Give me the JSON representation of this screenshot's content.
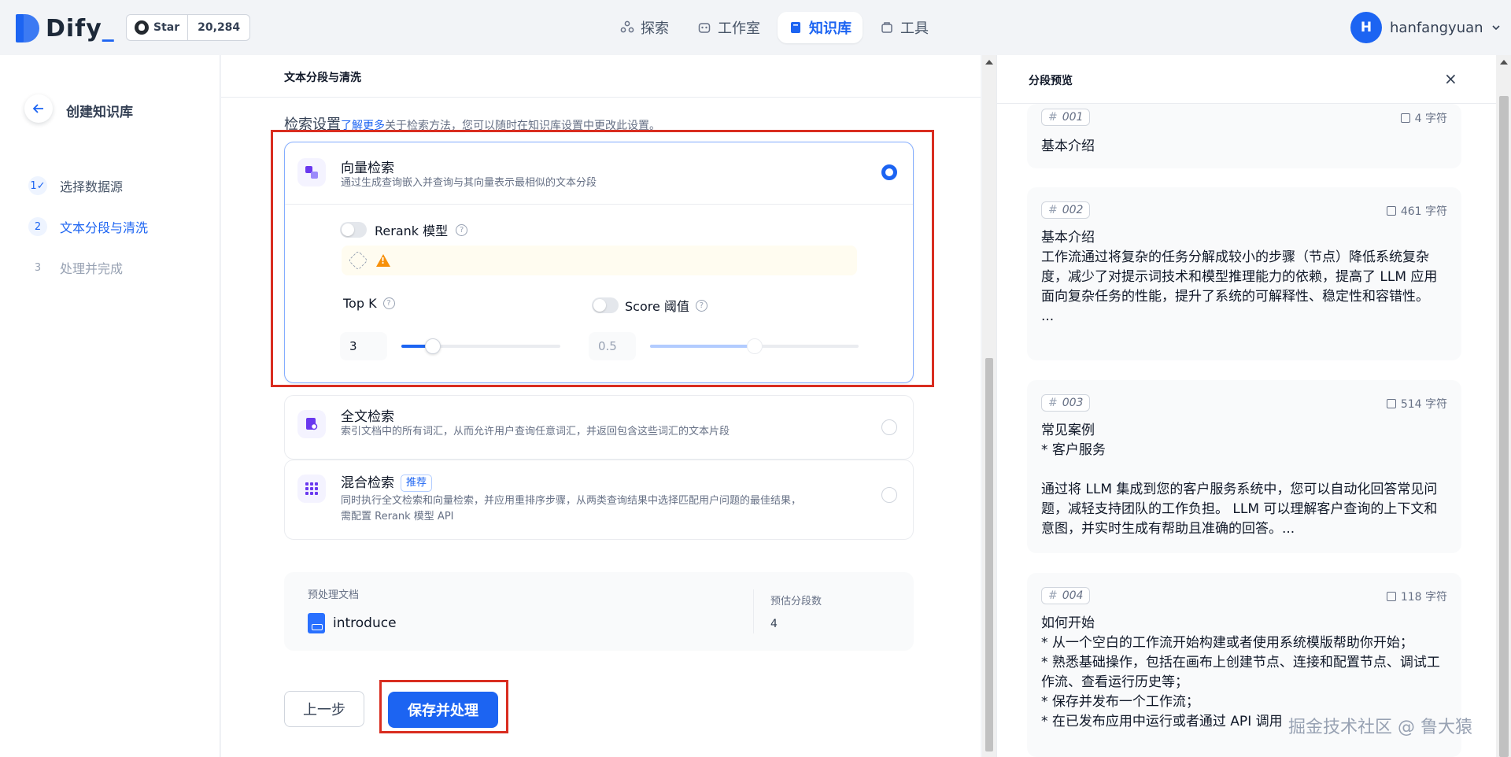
{
  "app": {
    "logo_text": "Dify",
    "github": {
      "star_label": "Star",
      "star_count": "20,284"
    }
  },
  "nav": [
    {
      "label": "探索",
      "icon": "explore-icon",
      "active": false
    },
    {
      "label": "工作室",
      "icon": "robot-icon",
      "active": false
    },
    {
      "label": "知识库",
      "icon": "book-icon",
      "active": true
    },
    {
      "label": "工具",
      "icon": "toolbox-icon",
      "active": false
    }
  ],
  "user": {
    "initial": "H",
    "name": "hanfangyuan"
  },
  "sidebar": {
    "title": "创建知识库",
    "steps": [
      {
        "num": "1",
        "label": "选择数据源",
        "state": "done"
      },
      {
        "num": "2",
        "label": "文本分段与清洗",
        "state": "active"
      },
      {
        "num": "3",
        "label": "处理并完成",
        "state": "pending"
      }
    ]
  },
  "main": {
    "header": "文本分段与清洗",
    "retrieval": {
      "section_title": "检索设置",
      "learn_more": "了解更多",
      "hint": "关于检索方法，您可以随时在知识库设置中更改此设置。",
      "vector": {
        "title": "向量检索",
        "desc": "通过生成查询嵌入并查询与其向量表示最相似的文本分段",
        "rerank_label": "Rerank 模型",
        "topk_label": "Top K",
        "topk_value": "3",
        "topk_fraction": 0.2,
        "score_label": "Score 阈值",
        "score_value": "0.5",
        "score_fraction": 0.5
      },
      "fulltext": {
        "title": "全文检索",
        "desc": "索引文档中的所有词汇，从而允许用户查询任意词汇，并返回包含这些词汇的文本片段"
      },
      "hybrid": {
        "title": "混合检索",
        "badge": "推荐",
        "desc_line1": "同时执行全文检索和向量检索，并应用重排序步骤，从两类查询结果中选择匹配用户问题的最佳结果，",
        "desc_line2": "需配置 Rerank 模型 API"
      }
    },
    "stats": {
      "doc_label": "预处理文档",
      "doc_name": "introduce",
      "seg_label": "预估分段数",
      "seg_count": "4"
    },
    "buttons": {
      "prev": "上一步",
      "save": "保存并处理"
    }
  },
  "preview": {
    "title": "分段预览",
    "close": "×",
    "segments": [
      {
        "id": "001",
        "chars": "4 字符",
        "content": "基本介绍"
      },
      {
        "id": "002",
        "chars": "461 字符",
        "content": "基本介绍\n工作流通过将复杂的任务分解成较小的步骤（节点）降低系统复杂度，减少了对提示词技术和模型推理能力的依赖，提高了 LLM 应用面向复杂任务的性能，提升了系统的可解释性、稳定性和容错性。\n..."
      },
      {
        "id": "003",
        "chars": "514 字符",
        "content": "常见案例\n* 客户服务\n\n通过将 LLM 集成到您的客户服务系统中，您可以自动化回答常见问题，减轻支持团队的工作负担。 LLM 可以理解客户查询的上下文和意图，并实时生成有帮助且准确的回答。..."
      },
      {
        "id": "004",
        "chars": "118 字符",
        "content": "如何开始\n* 从一个空白的工作流开始构建或者使用系统模版帮助你开始；\n* 熟悉基础操作，包括在画布上创建节点、连接和配置节点、调试工作流、查看运行历史等；\n* 保存并发布一个工作流；\n* 在已发布应用中运行或者通过 API 调用"
      }
    ]
  },
  "watermark": "掘金技术社区 @ 鲁大猿",
  "colors": {
    "accent": "#1c64f2",
    "highlight_border": "#d92d20",
    "warning": "#f79009"
  }
}
